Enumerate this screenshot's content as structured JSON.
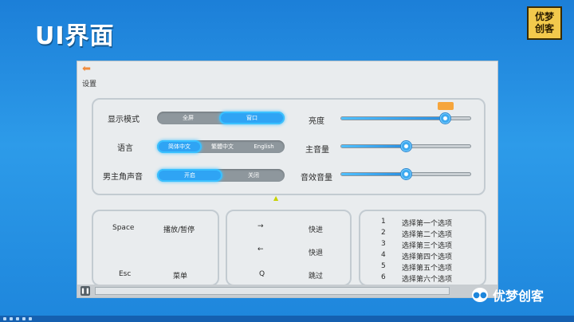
{
  "slide": {
    "title": "UI界面"
  },
  "logo": {
    "line1": "优梦",
    "line2": "创客"
  },
  "screen": {
    "back_icon": "back-arrow-icon",
    "title": "设置",
    "display": {
      "label": "显示模式",
      "options": [
        "全屏",
        "窗口"
      ],
      "selected": "窗口"
    },
    "language": {
      "label": "语言",
      "options": [
        "简体中文",
        "繁體中文",
        "English"
      ],
      "selected": "简体中文"
    },
    "voice": {
      "label": "男主角声音",
      "options": [
        "开启",
        "关闭"
      ],
      "selected": "开启"
    },
    "brightness": {
      "label": "亮度",
      "value": 0.8
    },
    "master_volume": {
      "label": "主音量",
      "value": 0.5
    },
    "sfx_volume": {
      "label": "音效音量",
      "value": 0.5
    },
    "keys": [
      {
        "key": "Space",
        "action": "播放/暂停"
      },
      {
        "key": "Esc",
        "action": "菜单"
      }
    ],
    "arrows": [
      {
        "key": "→",
        "action": "快进"
      },
      {
        "key": "←",
        "action": "快退"
      },
      {
        "key": "Q",
        "action": "跳过"
      }
    ],
    "choices": [
      {
        "num": "1",
        "text": "选择第一个选项"
      },
      {
        "num": "2",
        "text": "选择第二个选项"
      },
      {
        "num": "3",
        "text": "选择第三个选项"
      },
      {
        "num": "4",
        "text": "选择第四个选项"
      },
      {
        "num": "5",
        "text": "选择第五个选项"
      },
      {
        "num": "6",
        "text": "选择第六个选项"
      }
    ],
    "pause_icon": "pause-icon"
  },
  "watermark": {
    "text": "优梦创客"
  },
  "colors": {
    "accent": "#2fa4f4",
    "background": "#1c7fd8",
    "logo": "#f2c94c"
  }
}
